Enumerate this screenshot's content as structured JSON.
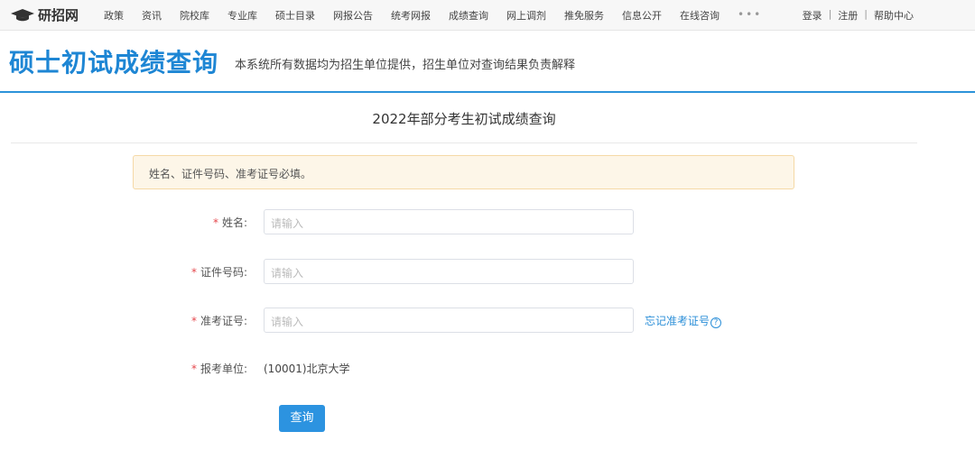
{
  "nav": {
    "logo": "研招网",
    "items": [
      "政策",
      "资讯",
      "院校库",
      "专业库",
      "硕士目录",
      "网报公告",
      "统考网报",
      "成绩查询",
      "网上调剂",
      "推免服务",
      "信息公开",
      "在线咨询"
    ],
    "more": "•••",
    "login": "登录",
    "register": "注册",
    "help": "帮助中心",
    "sep": "|"
  },
  "header": {
    "title": "硕士初试成绩查询",
    "subtitle": "本系统所有数据均为招生单位提供，招生单位对查询结果负责解释"
  },
  "page_title": "2022年部分考生初试成绩查询",
  "alert": "姓名、证件号码、准考证号必填。",
  "form": {
    "required_mark": "*",
    "name_label": "姓名:",
    "id_label": "证件号码:",
    "exam_label": "准考证号:",
    "unit_label": "报考单位:",
    "placeholder": "请输入",
    "unit_value": "(10001)北京大学",
    "forgot": "忘记准考证号",
    "submit": "查询"
  }
}
